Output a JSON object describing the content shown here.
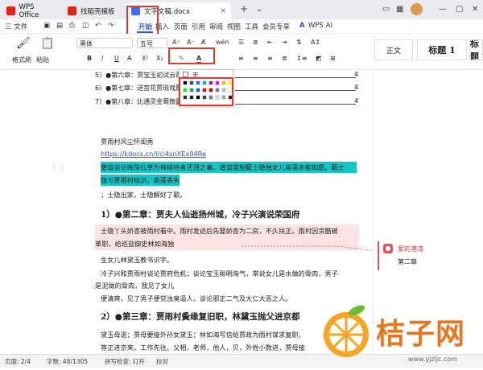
{
  "tabs": [
    {
      "label": "WPS Office",
      "color": "#e2231a"
    },
    {
      "label": "找稻壳模板",
      "color": "#e2231a"
    },
    {
      "label": "文字文稿.docx",
      "color": "#3d6ef5"
    }
  ],
  "menubar": {
    "file": "三 文件",
    "items": [
      "开始",
      "插入",
      "页面",
      "引用",
      "审阅",
      "视图",
      "工具",
      "会员专享"
    ],
    "wps_ai": "WPS AI"
  },
  "ribbon": {
    "format_painter": "格式刷",
    "paste": "粘贴",
    "font": "黑体",
    "size": "五号",
    "style_normal": "正文",
    "style_title": "标题 1",
    "style_title2": "标题"
  },
  "color_popup": {
    "none_label": "无",
    "colors": [
      "#000000",
      "#1f4e79",
      "#2e75b6",
      "#00b0f0",
      "#7030a0",
      "#ff00ff",
      "#ffc000",
      "#ffff00",
      "#00ff00",
      "#00b050",
      "#0070c0",
      "#ff0000",
      "#c00000",
      "#7f7f7f",
      "#bfbfbf",
      "#ffffff",
      "#333333",
      "#002060",
      "#000000",
      "#404040",
      "#808080",
      "#d9d9d9",
      "#a6a6a6",
      "#262626"
    ]
  },
  "toc": [
    {
      "label": "5）●第六章：贾宝玉初试云雨情",
      "page": "4"
    },
    {
      "label": "6）●第七章：送宫花贾琏戏熙凤",
      "page": "4"
    },
    {
      "label": "7）●第八章：比通灵金莺微露意",
      "page": "4"
    }
  ],
  "document": {
    "author": "贾雨村风尘怀闺秀",
    "link": "https://kdocs.cn/l/ci4snXEx04Re",
    "hl1": "僧道谈论绛珠仙草为神瑛侍者还泪之事。僧道度脱甄士隐独女儿英莲未能如愿。甄士",
    "hl2": "隐与贾雨村结识。英莲丢失",
    "line1": "；士隐出家，士隐解好了歌。",
    "h1": "1）●第二章：贾夫人仙逝扬州城，冷子兴演说荣国府",
    "pink1": "士隐丫头娇杏被雨村看中。雨村发迹后先娶娇杏为二房，不久扶正。雨村因贪酷被",
    "pink2": "革职，给巡盐御史林如海独",
    "p1": "生女儿林黛玉教书识字。",
    "p2": "冷子兴和贾雨村谈论贾府危机；谈论宝玉聪明淘气，常说女儿是水做的骨肉，男子",
    "p3": "是泥做的骨肉，我见了女儿",
    "p4": "便清爽，见了男子便觉浊臭逼人，谈论邪正二气及大仁大恶之人。",
    "h2": "2）●第三章：贾雨村夤缘复旧职，林黛玉抛父进京都",
    "p5": "黛玉母逝；贾母要接外孙女黛玉；林如海写信给贾政为雨村谋求复职，",
    "p6": "等正进京来，工作先往。父相，老师，他人，贝，外姓小数进，贾母接"
  },
  "comment": {
    "user": "爱的港湾",
    "text": "第二章"
  },
  "status": {
    "page": "页面: 2/4",
    "words": "字数: 48/1305",
    "spell": "拼写检查: 打开",
    "proof": "校对"
  },
  "watermark": {
    "text": "桔子网",
    "url": "www.yjzljc.com"
  }
}
